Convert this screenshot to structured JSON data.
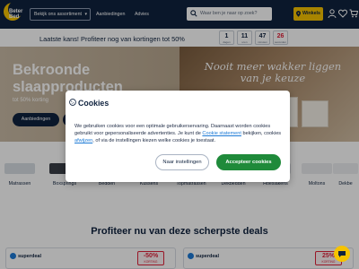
{
  "header": {
    "logo_line1": "Beter",
    "logo_line2": "Bed",
    "assortment_label": "Bekijk ons assortiment",
    "nav_links": [
      "Aanbiedingen",
      "Advies"
    ],
    "search_placeholder": "Waar ben je naar op zoek?",
    "stores_label": "Winkels"
  },
  "promo": {
    "text": "Laatste kans! Profiteer nog van kortingen tot 50%",
    "countdown": [
      {
        "value": "1",
        "label": "dagen"
      },
      {
        "value": "11",
        "label": "uren"
      },
      {
        "value": "47",
        "label": "minuten"
      },
      {
        "value": "26",
        "label": "seconden"
      }
    ]
  },
  "hero": {
    "title": "Bekroonde slaapproducten",
    "subtitle": "tot 50% korting",
    "button_label": "Aanbiedingen",
    "script_text": "Nooit meer wakker liggen van je keuze"
  },
  "categories": [
    "Matrassen",
    "Boxsprings",
    "Bedden",
    "Kussens",
    "Topmatrassen",
    "Dekbedden",
    "Hoeslakens",
    "Moltons",
    "Dekbe"
  ],
  "deals": {
    "title": "Profiteer nu van deze scherpste deals",
    "cards": [
      {
        "tag": "superdeal",
        "discount": "-50%",
        "discount_label": "KORTING"
      },
      {
        "tag": "superdeal",
        "discount": "25%",
        "discount_label": "KORTING"
      }
    ]
  },
  "cookie_modal": {
    "title": "Cookies",
    "body_part1": "We gebruiken cookies voor een optimale gebruikerservaring. Daarnaast worden cookies gebruikt voor gepersonaliseerde advertenties. Je kunt de ",
    "statement_link": "Cookie statement",
    "body_part2": " bekijken, cookies ",
    "decline_link": "afwijzen",
    "body_part3": ", of via de instellingen kiezen welke cookies je toestaat.",
    "settings_button": "Naar instellingen",
    "accept_button": "Accepteer cookies"
  },
  "colors": {
    "navy": "#10233f",
    "yellow": "#f6c300",
    "accept_green": "#1f8a3a",
    "discount_red": "#e0223a",
    "link_blue": "#1c7ad6"
  },
  "icons": [
    "search-icon",
    "location-pin-icon",
    "user-icon",
    "heart-icon",
    "cart-icon",
    "cookie-icon",
    "chat-icon",
    "lightning-icon"
  ]
}
